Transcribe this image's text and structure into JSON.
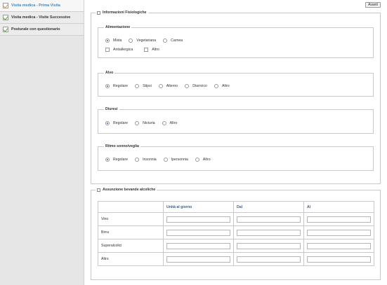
{
  "sidebar": {
    "items": [
      {
        "label": "Visita medica - Prima Visita",
        "active": true,
        "icon": "pencil-note-icon"
      },
      {
        "label": "Visita medica - Visite Successive",
        "active": false,
        "icon": "check-note-icon"
      },
      {
        "label": "Posturale con questionario",
        "active": false,
        "icon": "check-note-icon"
      }
    ]
  },
  "toolbar": {
    "next_label": "Avanti"
  },
  "physiology": {
    "title": "Informazioni Fisiologiche",
    "alimentazione": {
      "title": "Alimentazione",
      "radios": [
        {
          "label": "Mista",
          "checked": true
        },
        {
          "label": "Vegetariana",
          "checked": false
        },
        {
          "label": "Carnea",
          "checked": false
        }
      ],
      "checks": [
        {
          "label": "Antiallergica",
          "checked": false
        },
        {
          "label": "Altro",
          "checked": false
        }
      ]
    },
    "alvo": {
      "title": "Alvo",
      "radios": [
        {
          "label": "Regolare",
          "checked": true
        },
        {
          "label": "Stipsi",
          "checked": false
        },
        {
          "label": "Alterno",
          "checked": false
        },
        {
          "label": "Diarroico",
          "checked": false
        },
        {
          "label": "Altro",
          "checked": false
        }
      ]
    },
    "diuresi": {
      "title": "Diuresi",
      "radios": [
        {
          "label": "Regolare",
          "checked": true
        },
        {
          "label": "Nicturia",
          "checked": false
        },
        {
          "label": "Altro",
          "checked": false
        }
      ]
    },
    "sonno": {
      "title": "Ritmo sonno/veglia",
      "radios": [
        {
          "label": "Regolare",
          "checked": true
        },
        {
          "label": "Insonnia",
          "checked": false
        },
        {
          "label": "Ipersonnia",
          "checked": false
        },
        {
          "label": "Altro",
          "checked": false
        }
      ]
    }
  },
  "beverages": {
    "title": "Assunzione bevande alcoliche",
    "columns": [
      "Unità al giorno",
      "Dal",
      "Al"
    ],
    "rows": [
      "Vino",
      "Birra",
      "Superalcolici",
      "Altro"
    ]
  }
}
